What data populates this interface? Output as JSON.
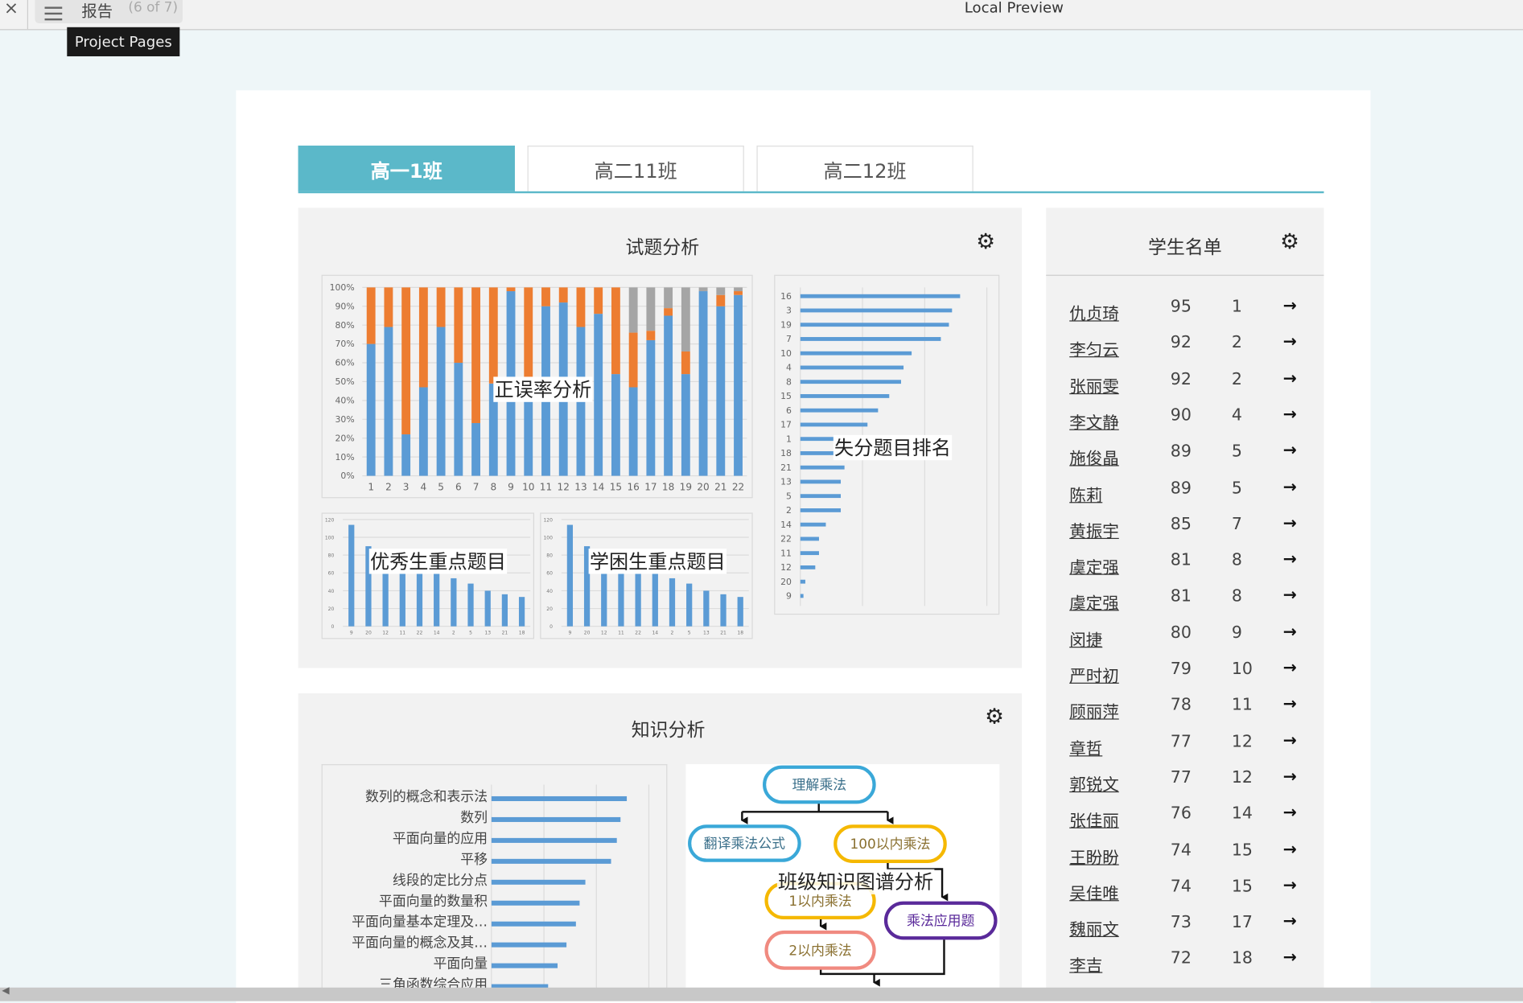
{
  "topbar": {
    "close_icon": "close-icon",
    "menu_icon": "hamburger-menu-icon",
    "menu_title": "报告",
    "page_count": "(6 of 7)",
    "app_title": "Local Preview",
    "tooltip": "Project Pages"
  },
  "tabs": [
    {
      "label": "高一1班",
      "active": true
    },
    {
      "label": "高二11班",
      "active": false
    },
    {
      "label": "高二12班",
      "active": false
    }
  ],
  "colors": {
    "accent": "#5bb8c9",
    "correct": "#5b9bd5",
    "wrong": "#ed7d31",
    "other": "#a5a5a5"
  },
  "question_panel": {
    "title": "试题分析",
    "settings_icon": "gear-icon"
  },
  "knowledge_panel": {
    "title": "知识分析",
    "settings_icon": "gear-icon"
  },
  "chart_data": [
    {
      "type": "bar",
      "stacked": true,
      "title": "正误率分析",
      "categories": [
        "1",
        "2",
        "3",
        "4",
        "5",
        "6",
        "7",
        "8",
        "9",
        "10",
        "11",
        "12",
        "13",
        "14",
        "15",
        "16",
        "17",
        "18",
        "19",
        "20",
        "21",
        "22"
      ],
      "series": [
        {
          "values": [
            70,
            79,
            22,
            47,
            79,
            60,
            28,
            49,
            98,
            41,
            90,
            92,
            79,
            86,
            54,
            47,
            72,
            85,
            54,
            98,
            90,
            96
          ]
        },
        {
          "values": [
            30,
            21,
            78,
            53,
            21,
            40,
            72,
            51,
            2,
            59,
            10,
            8,
            21,
            14,
            46,
            29,
            5,
            4,
            12,
            0,
            6,
            2
          ]
        },
        {
          "values": [
            0,
            0,
            0,
            0,
            0,
            0,
            0,
            0,
            0,
            0,
            0,
            0,
            0,
            0,
            0,
            24,
            23,
            11,
            34,
            2,
            4,
            2
          ]
        }
      ],
      "yticks": [
        "0%",
        "10%",
        "20%",
        "30%",
        "40%",
        "50%",
        "60%",
        "70%",
        "80%",
        "90%",
        "100%"
      ],
      "ylim": [
        0,
        100
      ],
      "grid": true
    },
    {
      "type": "bar",
      "orientation": "horizontal",
      "title": "失分题目排名",
      "categories": [
        "16",
        "3",
        "19",
        "7",
        "10",
        "4",
        "8",
        "15",
        "6",
        "17",
        "1",
        "18",
        "21",
        "13",
        "5",
        "2",
        "14",
        "22",
        "11",
        "12",
        "20",
        "9"
      ],
      "values": [
        25.7,
        24.4,
        23.9,
        22.6,
        17.9,
        16.6,
        16.2,
        14.3,
        12.5,
        10.8,
        8.5,
        7.8,
        7.1,
        6.5,
        6.5,
        6.5,
        4.1,
        3.0,
        3.0,
        2.4,
        0.8,
        0.5
      ],
      "xlim": [
        0,
        30
      ],
      "grid": true
    },
    {
      "type": "bar",
      "title": "优秀生重点题目",
      "categories": [
        "9",
        "20",
        "12",
        "11",
        "22",
        "14",
        "2",
        "5",
        "13",
        "21",
        "18"
      ],
      "values": [
        114,
        90,
        63,
        63,
        63,
        63,
        54,
        48,
        40,
        36,
        33
      ],
      "yticks": [
        "0",
        "20",
        "40",
        "60",
        "80",
        "100",
        "120"
      ],
      "ylim": [
        0,
        120
      ],
      "grid": true
    },
    {
      "type": "bar",
      "title": "学困生重点题目",
      "categories": [
        "9",
        "20",
        "12",
        "11",
        "22",
        "14",
        "2",
        "5",
        "13",
        "21",
        "18"
      ],
      "values": [
        114,
        90,
        63,
        63,
        63,
        63,
        54,
        48,
        40,
        36,
        33
      ],
      "yticks": [
        "0",
        "20",
        "40",
        "60",
        "80",
        "100",
        "120"
      ],
      "ylim": [
        0,
        120
      ],
      "grid": true
    },
    {
      "type": "bar",
      "orientation": "horizontal",
      "categories": [
        "数列的概念和表示法",
        "数列",
        "平面向量的应用",
        "平移",
        "线段的定比分点",
        "平面向量的数量积",
        "平面向量基本定理及…",
        "平面向量的概念及其…",
        "平面向量",
        "三角函数综合应用"
      ],
      "values": [
        2.58,
        2.46,
        2.39,
        2.28,
        1.79,
        1.68,
        1.61,
        1.43,
        1.26,
        1.08
      ],
      "xlim": [
        0,
        3
      ],
      "grid": true
    }
  ],
  "knowledge_map": {
    "title": "班级知识图谱分析",
    "nodes": [
      {
        "label": "理解乘法",
        "color": "#3aa8d8"
      },
      {
        "label": "翻译乘法公式",
        "color": "#3aa8d8"
      },
      {
        "label": "100以内乘法",
        "color": "#f5b800"
      },
      {
        "label": "1以内乘法",
        "color": "#f5b800"
      },
      {
        "label": "乘法应用题",
        "color": "#5a2a9a"
      },
      {
        "label": "2以内乘法",
        "color": "#f08a80"
      }
    ]
  },
  "students": {
    "title": "学生名单",
    "settings_icon": "gear-icon",
    "rows": [
      {
        "name": "仇贞琦",
        "score": "95",
        "rank": "1"
      },
      {
        "name": "李匀云",
        "score": "92",
        "rank": "2"
      },
      {
        "name": "张丽雯",
        "score": "92",
        "rank": "2"
      },
      {
        "name": "李文静",
        "score": "90",
        "rank": "4"
      },
      {
        "name": "施俊晶",
        "score": "89",
        "rank": "5"
      },
      {
        "name": "陈莉",
        "score": "89",
        "rank": "5"
      },
      {
        "name": "黄振宇",
        "score": "85",
        "rank": "7"
      },
      {
        "name": "虞定强",
        "score": "81",
        "rank": "8"
      },
      {
        "name": "虞定强",
        "score": "81",
        "rank": "8"
      },
      {
        "name": "闵捷",
        "score": "80",
        "rank": "9"
      },
      {
        "name": "严时初",
        "score": "79",
        "rank": "10"
      },
      {
        "name": "顾丽萍",
        "score": "78",
        "rank": "11"
      },
      {
        "name": "章哲",
        "score": "77",
        "rank": "12"
      },
      {
        "name": "郭锐文",
        "score": "77",
        "rank": "12"
      },
      {
        "name": "张佳丽",
        "score": "76",
        "rank": "14"
      },
      {
        "name": "王盼盼",
        "score": "74",
        "rank": "15"
      },
      {
        "name": "吴佳唯",
        "score": "74",
        "rank": "15"
      },
      {
        "name": "魏丽文",
        "score": "73",
        "rank": "17"
      },
      {
        "name": "李吉",
        "score": "72",
        "rank": "18"
      }
    ]
  }
}
